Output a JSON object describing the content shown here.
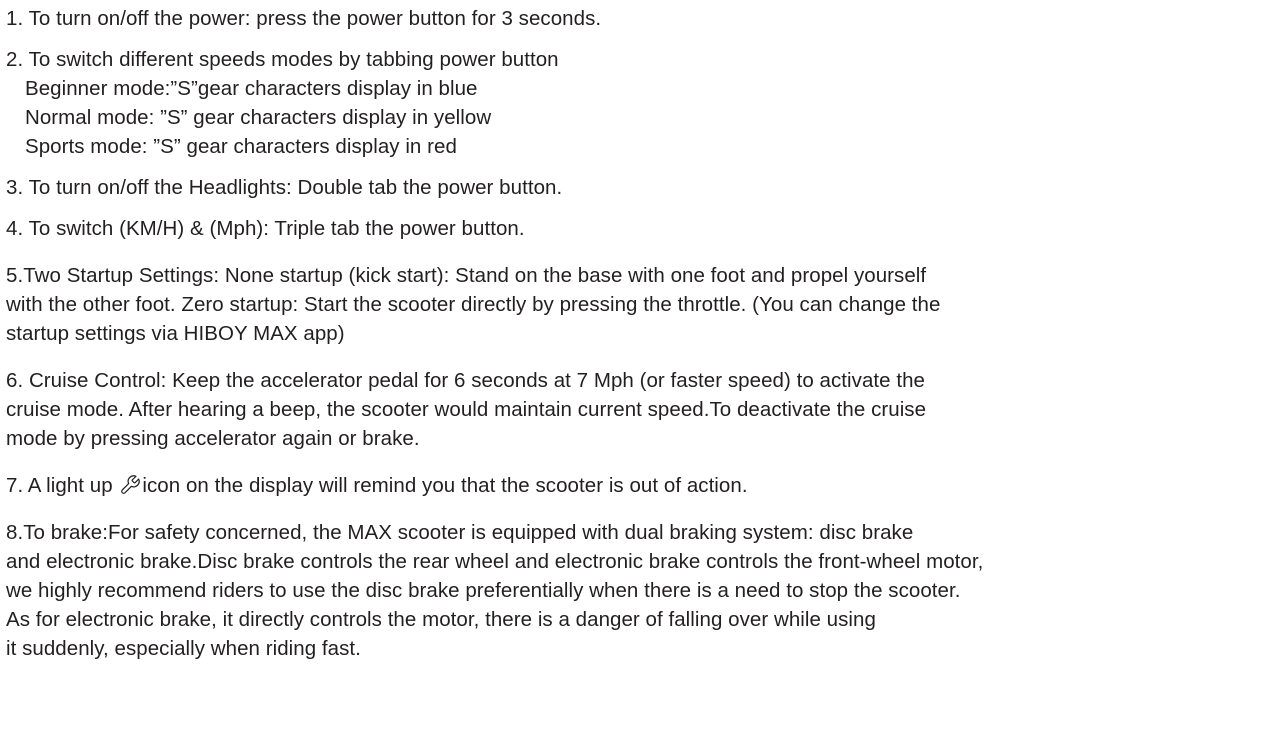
{
  "items": {
    "item1": "1. To turn on/off the power: press the power button for 3 seconds.",
    "item2": {
      "head": "2.  To switch different speeds modes by tabbing power button",
      "modes": [
        "Beginner mode:”S”gear characters display in blue",
        "Normal mode: ”S” gear characters display in yellow",
        "Sports mode: ”S” gear characters display in red"
      ]
    },
    "item3": "3. To turn on/off the Headlights: Double tab the power button.",
    "item4": "4. To switch (KM/H) & (Mph): Triple tab the power button.",
    "item5": [
      "5.Two Startup Settings: None startup (kick start): Stand on the base with one foot and propel yourself",
      "with the other foot. Zero startup: Start the scooter directly by pressing the throttle. (You can change the",
      "startup settings via HIBOY MAX app)"
    ],
    "item6": [
      "6. Cruise Control: Keep the accelerator pedal for 6 seconds at 7 Mph (or faster speed) to activate the",
      "cruise mode. After hearing a beep, the scooter would maintain current speed.To deactivate the cruise",
      "mode by pressing accelerator again or brake."
    ],
    "item7": {
      "before": "7. A light up ",
      "icon": "wrench-icon",
      "after": "icon on the display will remind you that the scooter is out of action."
    },
    "item8": [
      "8.To brake:For safety concerned, the MAX scooter is equipped with dual braking system: disc brake",
      "and electronic brake.Disc brake controls the rear wheel and electronic brake controls the front-wheel motor,",
      "we highly recommend riders to use the disc brake preferentially when there is a need to stop the scooter.",
      "As for electronic brake, it directly controls the motor, there is a danger of falling over while using",
      "it suddenly, especially when riding fast."
    ]
  }
}
